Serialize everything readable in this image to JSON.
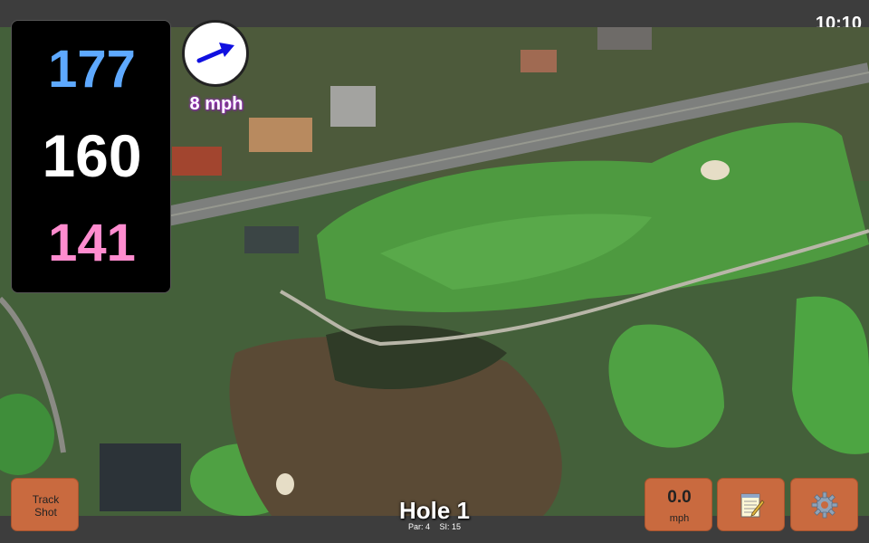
{
  "status": {
    "time": "10:10"
  },
  "yardages": {
    "back": "177",
    "middle": "160",
    "front": "141"
  },
  "wind": {
    "speed_label": "8 mph",
    "icon": "wind-direction-arrow-icon"
  },
  "hole": {
    "title": "Hole 1",
    "par": "Par: 4",
    "si": "SI: 15"
  },
  "buttons": {
    "track_shot": {
      "line1": "Track",
      "line2": "Shot"
    },
    "speed": {
      "value": "0.0",
      "unit": "mph"
    },
    "notes": {
      "icon": "notepad-icon"
    },
    "settings": {
      "icon": "gear-icon"
    }
  },
  "colors": {
    "back_yardage": "#5ea9ff",
    "front_yardage": "#ff8ccf",
    "button_bg": "#c96a3f",
    "wind_text_glow": "#a42fd0"
  }
}
